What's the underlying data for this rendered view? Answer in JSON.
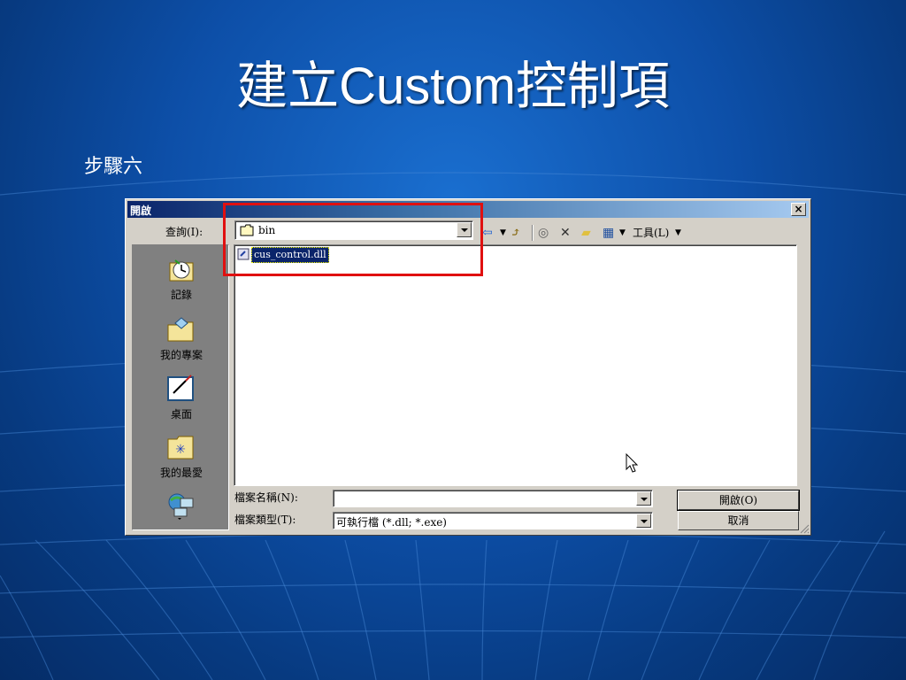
{
  "slide": {
    "title": "建立Custom控制項",
    "step": "步驟六"
  },
  "dialog": {
    "title": "開啟",
    "close_label": "×",
    "lookin_label": "查詢(I):",
    "lookin_value": "bin",
    "toolbar": {
      "back": "⇦",
      "up_folder": "⤴",
      "search_web": "◎",
      "delete": "✕",
      "new_folder": "▰",
      "views": "▦",
      "tools_label": "工具(L)"
    },
    "places": [
      {
        "label": "記錄",
        "icon": "history-icon"
      },
      {
        "label": "我的專案",
        "icon": "my-projects-icon"
      },
      {
        "label": "桌面",
        "icon": "desktop-icon"
      },
      {
        "label": "我的最愛",
        "icon": "favorites-icon"
      },
      {
        "label": "",
        "icon": "network-places-icon"
      }
    ],
    "files": [
      {
        "name": "cus_control.dll",
        "selected": true,
        "icon": "dll-file-icon"
      }
    ],
    "filename_label": "檔案名稱(N):",
    "filename_value": "",
    "filetype_label": "檔案類型(T):",
    "filetype_value": "可執行檔 (*.dll; *.exe)",
    "open_button": "開啟(O)",
    "cancel_button": "取消"
  },
  "colors": {
    "highlight_box": "#e01010",
    "selection": "#0a246a",
    "titlebar_start": "#0a246a",
    "titlebar_end": "#a6caf0"
  }
}
